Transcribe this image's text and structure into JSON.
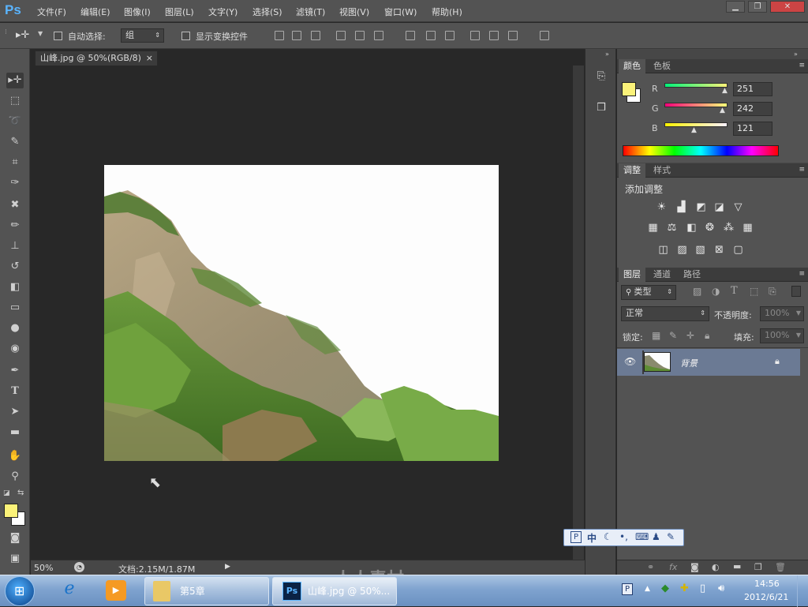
{
  "app": {
    "logo": "Ps"
  },
  "menu": [
    "文件(F)",
    "编辑(E)",
    "图像(I)",
    "图层(L)",
    "文字(Y)",
    "选择(S)",
    "滤镜(T)",
    "视图(V)",
    "窗口(W)",
    "帮助(H)"
  ],
  "window_buttons": {
    "minimize": "▁",
    "restore": "❐",
    "close": "✕"
  },
  "options": {
    "auto_select_label": "自动选择:",
    "auto_select_value": "组",
    "show_transform_label": "显示变换控件"
  },
  "document": {
    "tab_title": "山峰.jpg @ 50%(RGB/8)",
    "tab_close": "×"
  },
  "status": {
    "zoom": "50%",
    "doc_info": "文档:2.15M/1.87M"
  },
  "color_panel": {
    "tabs": [
      "颜色",
      "色板"
    ],
    "r_label": "R",
    "g_label": "G",
    "b_label": "B",
    "r": 251,
    "g": 242,
    "b": 121,
    "fg_color": "#fbf279"
  },
  "adjust_panel": {
    "tabs": [
      "调整",
      "样式"
    ],
    "title": "添加调整"
  },
  "layers_panel": {
    "tabs": [
      "图层",
      "通道",
      "路径"
    ],
    "filter_kind": "类型",
    "blend_mode": "正常",
    "opacity_label": "不透明度:",
    "opacity_value": "100%",
    "lock_label": "锁定:",
    "fill_label": "填充:",
    "fill_value": "100%",
    "layers": [
      {
        "name": "背景",
        "visible": true,
        "locked": true
      }
    ]
  },
  "ime": {
    "mode": "中"
  },
  "taskbar": {
    "buttons": [
      {
        "label": "第5章"
      },
      {
        "label": "山峰.jpg @ 50%..."
      }
    ],
    "time": "14:56",
    "date": "2012/6/21"
  },
  "watermark": "人人素材"
}
